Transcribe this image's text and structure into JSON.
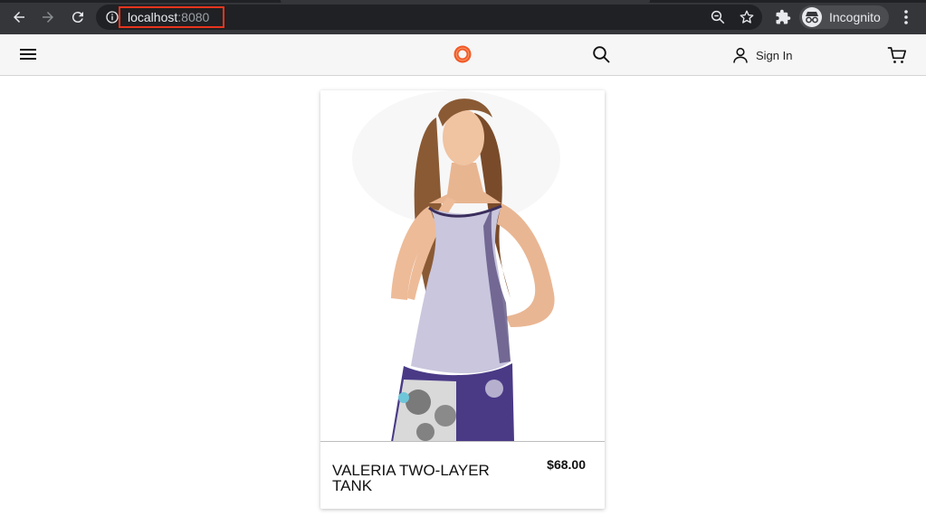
{
  "browser": {
    "url_host": "localhost",
    "url_port": ":8080",
    "profile_label": "Incognito",
    "icons": [
      "back-arrow-icon",
      "forward-arrow-icon",
      "reload-icon",
      "info-icon",
      "zoom-out-icon",
      "star-icon",
      "extensions-icon",
      "incognito-icon",
      "more-vert-icon"
    ]
  },
  "header": {
    "signin_label": "Sign In",
    "icons": [
      "hamburger-menu-icon",
      "logo-icon",
      "search-icon",
      "user-icon",
      "cart-icon"
    ],
    "accent_color": "#f15a29"
  },
  "product": {
    "name": "VALERIA TWO-LAYER TANK",
    "price": "$68.00"
  }
}
